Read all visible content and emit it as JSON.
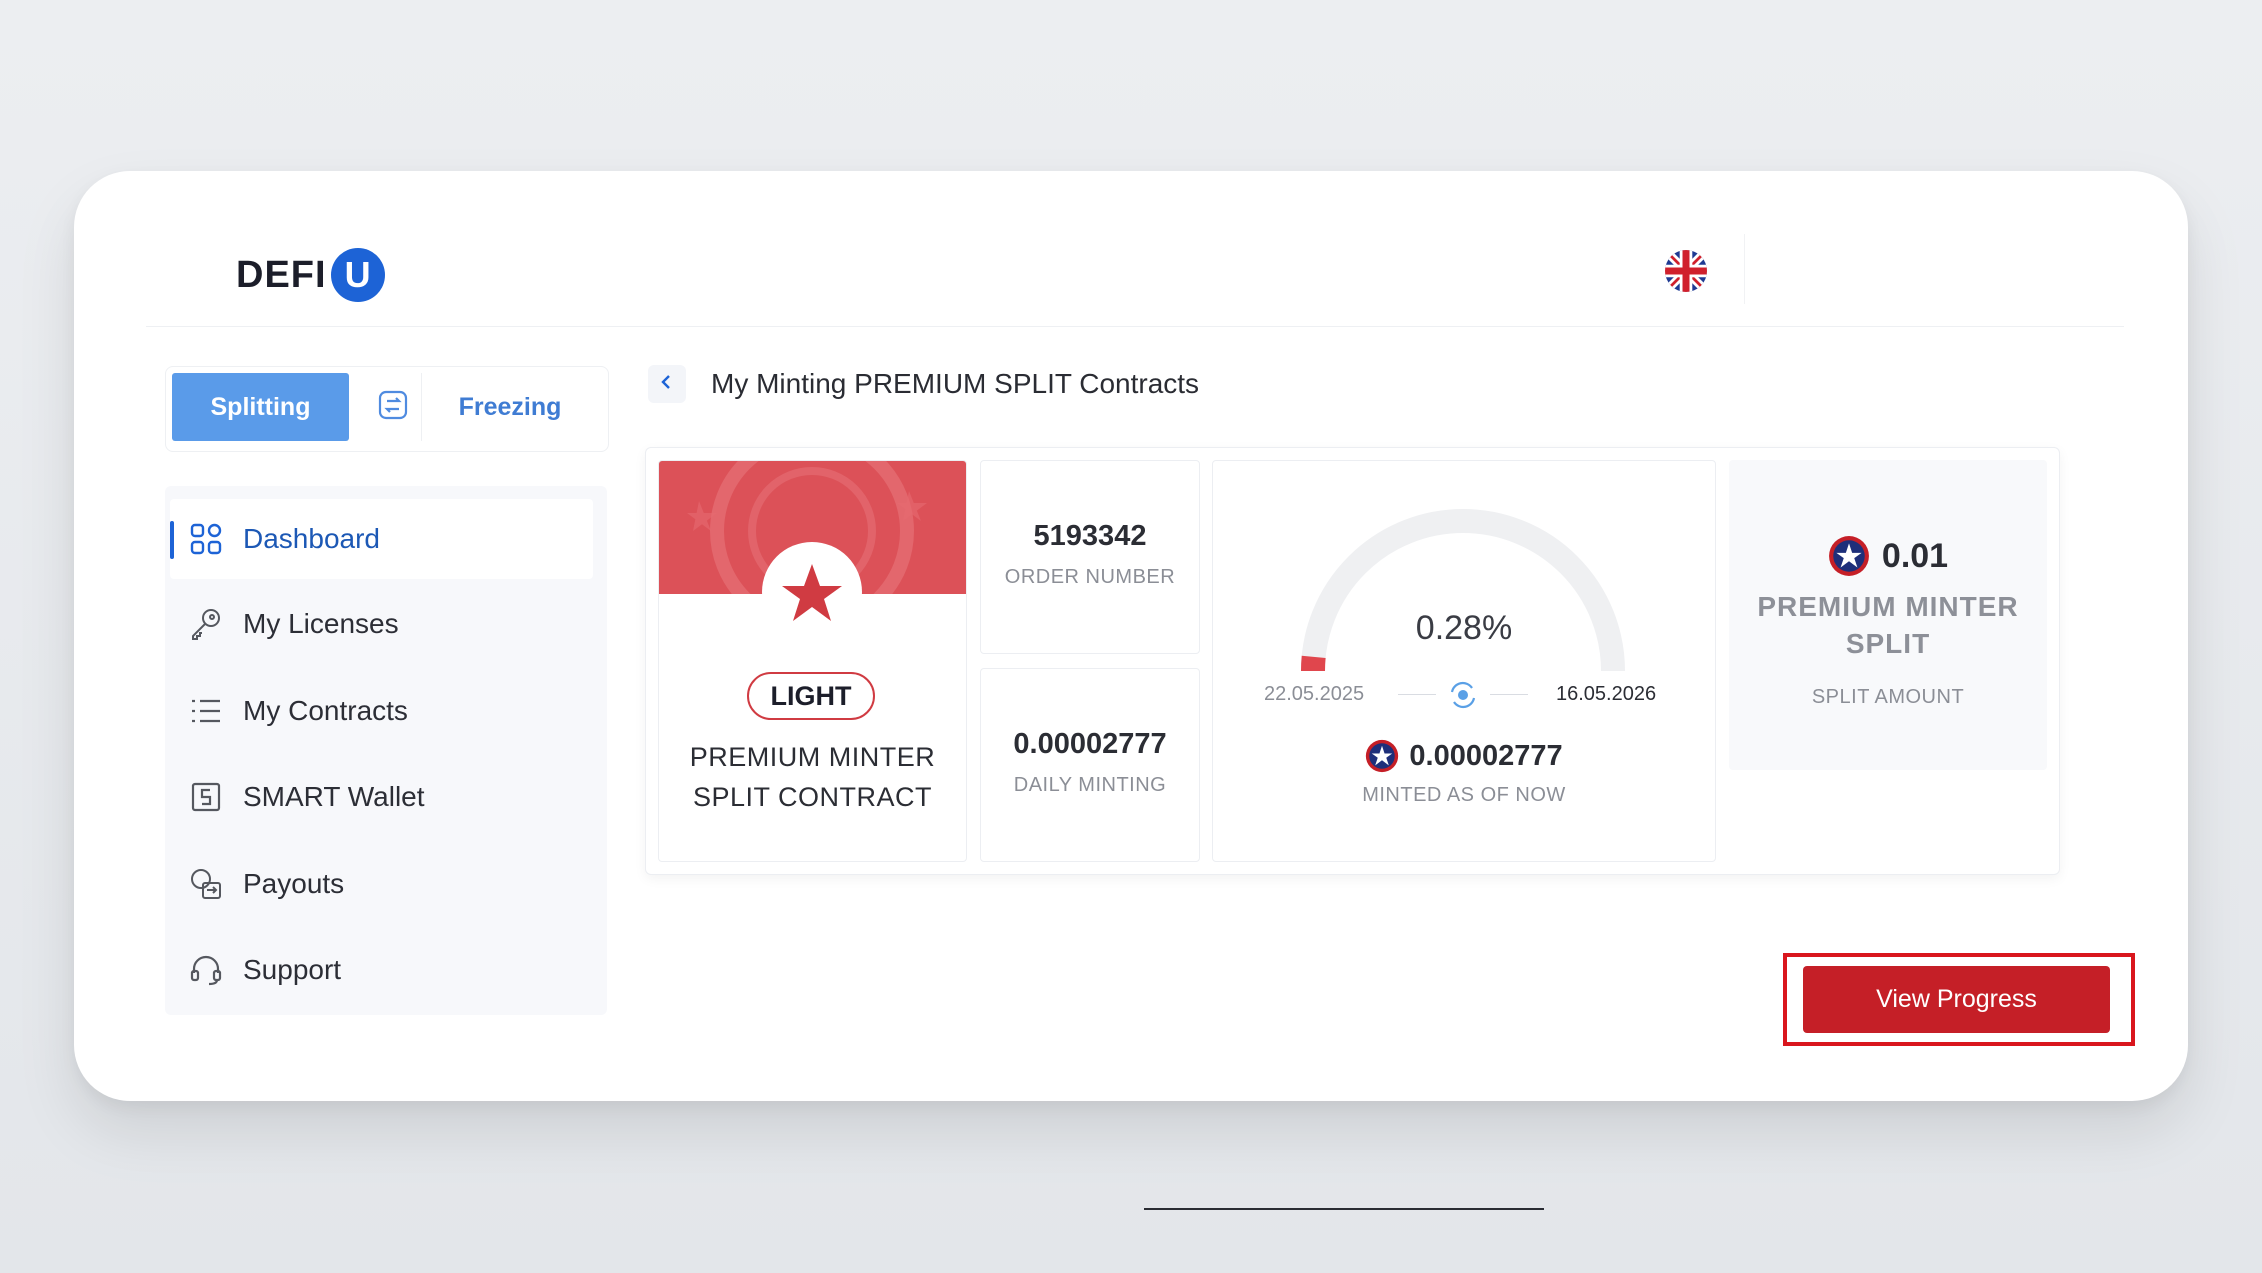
{
  "brand": {
    "logo_text": "DEFI",
    "logo_mark": "U"
  },
  "header": {
    "language_icon": "uk-flag-icon"
  },
  "mode_toggle": {
    "splitting_label": "Splitting",
    "freezing_label": "Freezing",
    "swap_icon": "swap-icon"
  },
  "sidebar": {
    "items": [
      {
        "label": "Dashboard",
        "icon": "grid-icon",
        "active": true
      },
      {
        "label": "My Licenses",
        "icon": "key-icon"
      },
      {
        "label": "My Contracts",
        "icon": "list-icon"
      },
      {
        "label": "SMART Wallet",
        "icon": "wallet-icon"
      },
      {
        "label": "Payouts",
        "icon": "payout-icon"
      },
      {
        "label": "Support",
        "icon": "headset-icon"
      }
    ]
  },
  "page": {
    "title": "My Minting PREMIUM SPLIT Contracts"
  },
  "contract": {
    "license_badge": "LIGHT",
    "license_name_line1": "PREMIUM MINTER",
    "license_name_line2": "SPLIT CONTRACT",
    "order_number": "5193342",
    "order_number_label": "ORDER NUMBER",
    "daily_minting": "0.00002777",
    "daily_minting_label": "DAILY MINTING",
    "progress_percent": "0.28%",
    "progress_fraction": 0.0028,
    "start_date": "22.05.2025",
    "end_date": "16.05.2026",
    "minted_value": "0.00002777",
    "minted_label": "MINTED AS OF NOW",
    "split_amount": "0.01",
    "split_name_line1": "PREMIUM MINTER",
    "split_name_line2": "SPLIT",
    "split_amount_label": "SPLIT AMOUNT",
    "view_button_label": "View Progress"
  },
  "colors": {
    "accent_blue": "#1d63d6",
    "toggle_blue": "#5a9be9",
    "brand_red": "#c51f27",
    "highlight_red": "#d9161d"
  }
}
